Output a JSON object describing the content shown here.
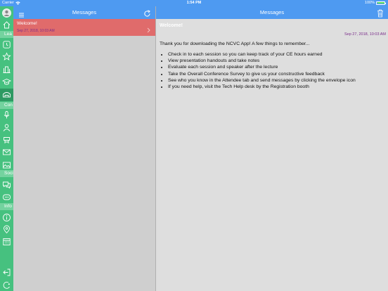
{
  "status_bar": {
    "carrier": "Carrier",
    "time": "1:54 PM",
    "battery": "100%"
  },
  "sidebar": {
    "sections": [
      "Lea",
      "Con",
      "Soci",
      "Info"
    ],
    "icons": [
      "avatar-icon",
      "home-icon",
      "clock-icon",
      "star-icon",
      "building-icon",
      "graduation-icon",
      "presentation-icon",
      "microphone-icon",
      "person-icon",
      "exhibitor-icon",
      "mail-icon",
      "photo-icon",
      "chat-icon",
      "message-icon",
      "info-icon",
      "map-pin-icon",
      "calendar-icon",
      "logout-icon",
      "settings-icon"
    ]
  },
  "list_panel": {
    "title": "Messages",
    "items": [
      {
        "subject": "Welcome!",
        "date": "Sep 27, 2018, 10:03 AM"
      }
    ]
  },
  "detail_panel": {
    "title": "Messages",
    "subject": "Welcome!",
    "date": "Sep 27, 2018, 10:03 AM",
    "intro": "Thank you for downloading the NCVC App! A few things to remember...",
    "bullets": [
      "Check in to each session so you can keep track of your CE hours earned",
      "View presentation handouts and take notes",
      "Evaluate each session and speaker after the lecture",
      "Take the Overall Conference Survey to give us your constructive feedback",
      "See who you know in the Attendee tab and send messages by clicking the envelope icon",
      "If you need help, visit the Tech Help desk by the Registration booth"
    ]
  },
  "colors": {
    "header": "#4e9af1",
    "sidebar": "#46c17f",
    "selected_item": "#e06b6b",
    "date_text": "#7a2c8a"
  }
}
